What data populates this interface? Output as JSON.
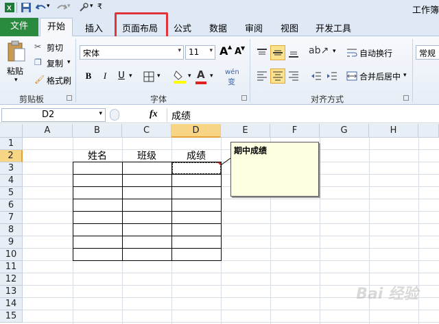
{
  "window": {
    "title": "工作簿"
  },
  "tabs": [
    "文件",
    "开始",
    "插入",
    "页面布局",
    "公式",
    "数据",
    "审阅",
    "视图",
    "开发工具"
  ],
  "ribbon": {
    "clipboard": {
      "paste": "粘贴",
      "cut": "剪切",
      "copy": "复制",
      "format_painter": "格式刷",
      "label": "剪贴板"
    },
    "font": {
      "name": "宋体",
      "size": "11",
      "bold": "B",
      "italic": "I",
      "underline": "U",
      "grow": "A",
      "shrink": "A",
      "phonetic": "wén",
      "label": "字体"
    },
    "alignment": {
      "wrap": "自动换行",
      "merge": "合并后居中",
      "label": "对齐方式"
    },
    "number": {
      "format": "常规"
    }
  },
  "formula_bar": {
    "name_box": "D2",
    "fx": "fx",
    "value": "成绩"
  },
  "columns": [
    "A",
    "B",
    "C",
    "D",
    "E",
    "F",
    "G",
    "H"
  ],
  "rows": [
    "1",
    "2",
    "3",
    "4",
    "5",
    "6",
    "7",
    "8",
    "9",
    "10",
    "11",
    "12",
    "13",
    "14",
    "15"
  ],
  "cells": {
    "B2": "姓名",
    "C2": "班级",
    "D2": "成绩"
  },
  "comment": {
    "text": "期中成绩"
  },
  "watermark": "Bai 经验",
  "colors": {
    "file_tab": "#2a8a3e",
    "highlight": "#e0343a",
    "active_header": "#f8d585",
    "comment_bg": "#ffffe1"
  }
}
